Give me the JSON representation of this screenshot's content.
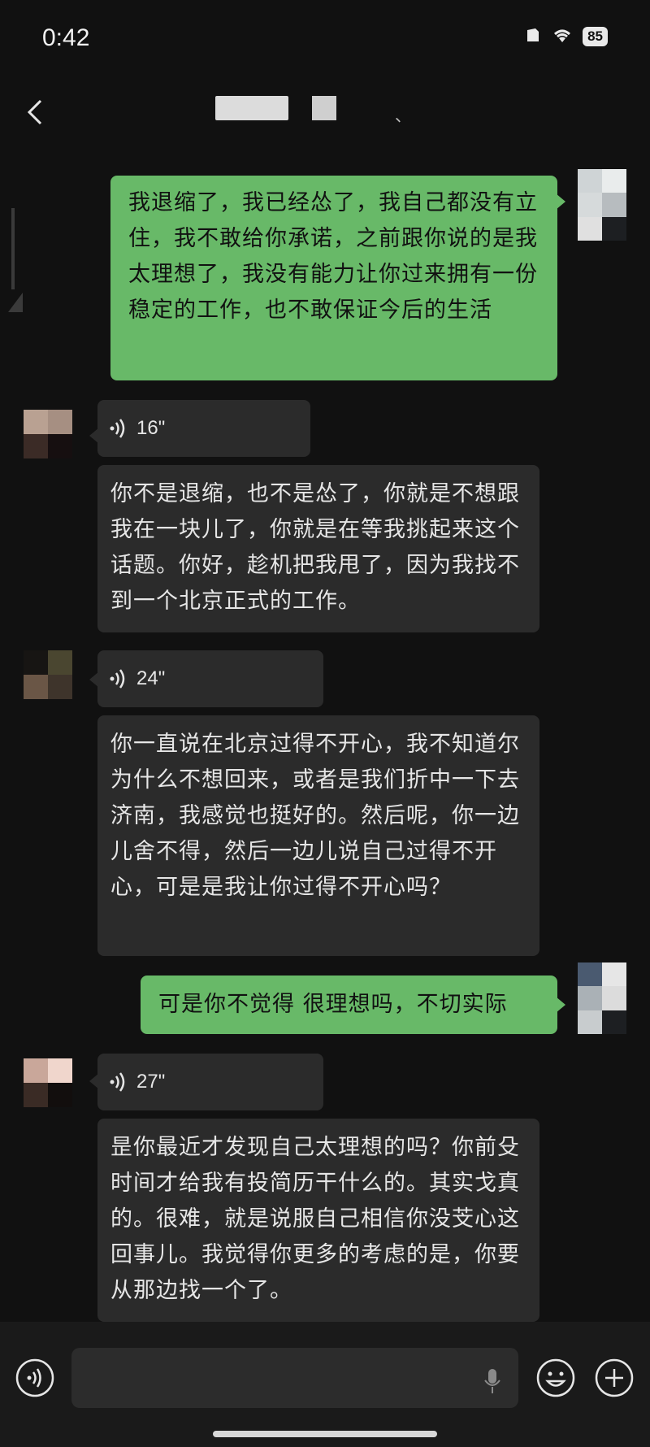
{
  "status_bar": {
    "time": "0:42",
    "battery_level": "85",
    "icons": [
      "sim-icon",
      "wifi-icon",
      "battery-icon"
    ]
  },
  "header": {
    "title_obscured": true,
    "back_icon": "chevron-left-icon",
    "title_mark": "、"
  },
  "messages": [
    {
      "type": "text",
      "side": "out",
      "text": "我退缩了，我已经怂了，我自己都没有立住，我不敢给你承诺，之前跟你说的是我太理想了，我没有能力让你过来拥有一份稳定的工作，也不敢保证今后的生活"
    },
    {
      "type": "voice",
      "side": "in",
      "duration": "16\""
    },
    {
      "type": "text",
      "side": "in",
      "text": "你不是退缩，也不是怂了，你就是不想跟我在一块儿了，你就是在等我挑起来这个话题。你好，趁机把我甩了，因为我找不到一个北京正式的工作。"
    },
    {
      "type": "voice",
      "side": "in",
      "duration": "24\""
    },
    {
      "type": "text",
      "side": "in",
      "text": "你一直说在北京过得不开心，我不知道尔为什么不想回来，或者是我们折中一下去济南，我感觉也挺好的。然后呢，你一边儿舍不得，然后一边儿说自己过得不开心，可是是我让你过得不开心吗？"
    },
    {
      "type": "text",
      "side": "out",
      "text": "可是你不觉得 很理想吗，不切实际"
    },
    {
      "type": "voice",
      "side": "in",
      "duration": "27\""
    },
    {
      "type": "text",
      "side": "in",
      "text": "昰你最近才发现自己太理想的吗？你前殳时间才给我有投简历干什么的。其实戈真的。很难，就是说服自己相信你没芠心这回事儿。我觉得你更多的考虑的是，你要从那边找一个了。"
    }
  ],
  "input_bar": {
    "voice_toggle_icon": "voice-mode-icon",
    "mic_icon": "microphone-icon",
    "emoji_icon": "emoji-icon",
    "plus_icon": "plus-icon"
  },
  "colors": {
    "background": "#111111",
    "outgoing_bubble": "#68b968",
    "incoming_bubble": "#2b2b2b",
    "input_bar": "#1a1a1a"
  }
}
